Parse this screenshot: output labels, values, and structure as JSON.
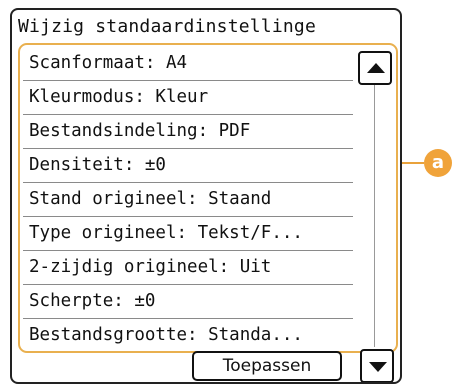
{
  "screen": {
    "title": "Wijzig standaardinstellinge",
    "items": [
      "Scanformaat: A4",
      "Kleurmodus: Kleur",
      "Bestandsindeling: PDF",
      "Densiteit: ±0",
      "Stand origineel: Staand",
      "Type origineel: Tekst/F...",
      "2-zijdig origineel: Uit",
      "Scherpte: ±0",
      "Bestandsgrootte: Standa..."
    ],
    "apply_label": "Toepassen"
  },
  "icons": {
    "scroll_up": "triangle-up",
    "scroll_down": "triangle-down"
  },
  "callout": {
    "label": "a",
    "color": "#f0a33a"
  }
}
